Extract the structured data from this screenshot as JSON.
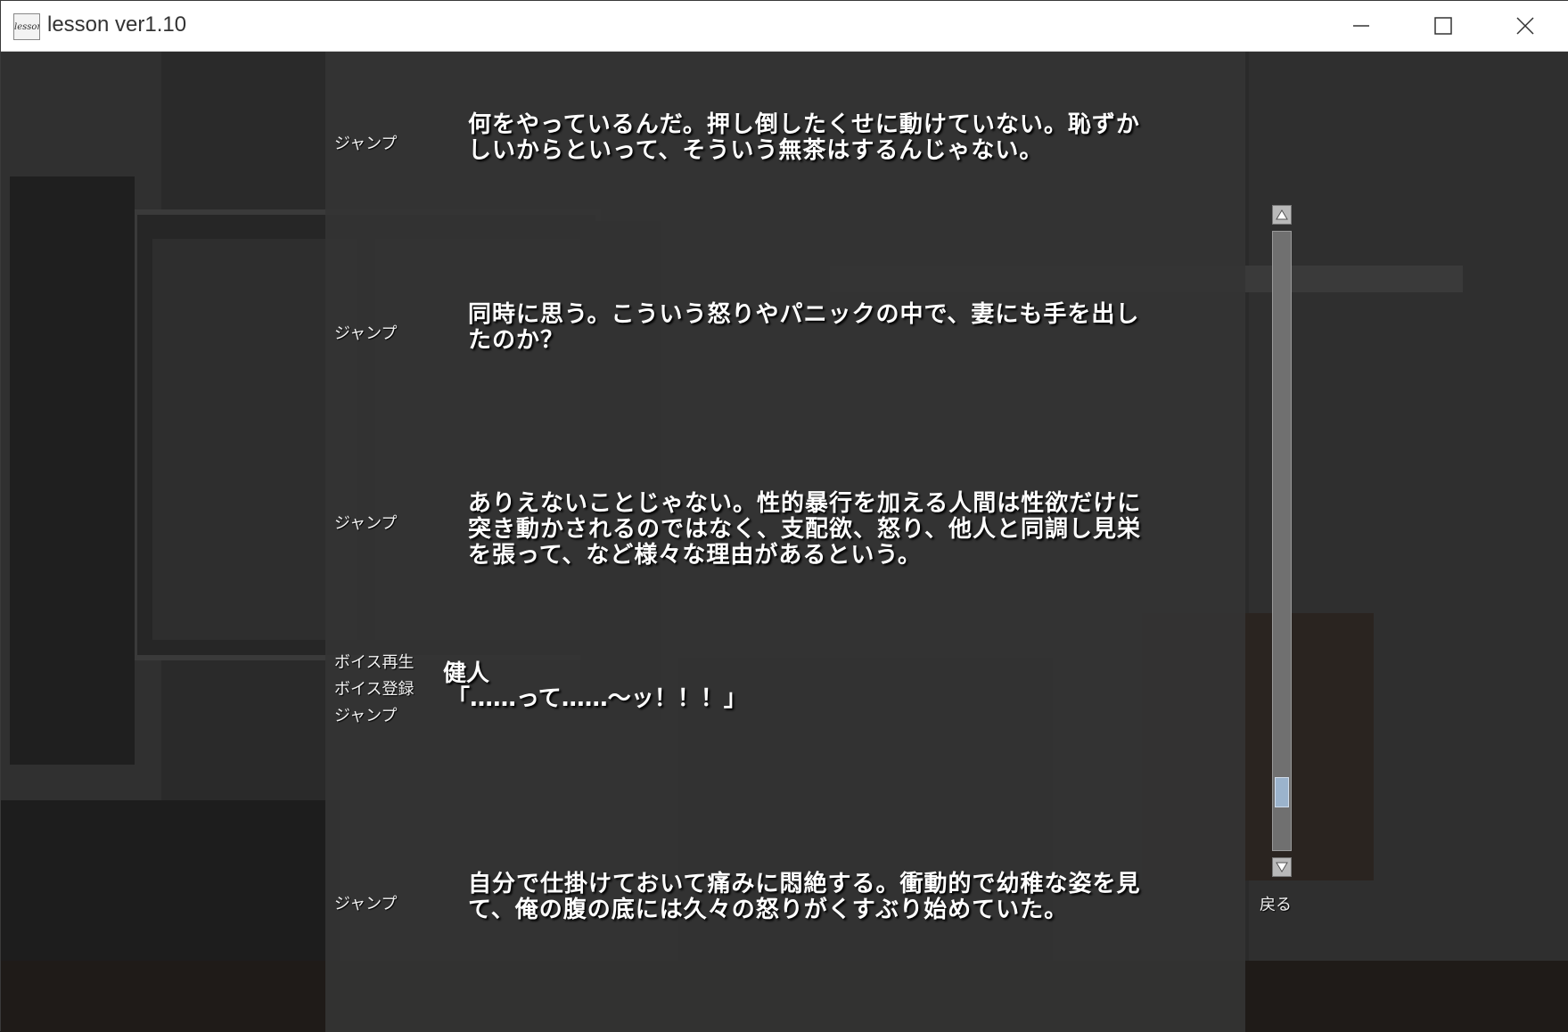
{
  "window": {
    "title": "lesson ver1.10",
    "app_icon_text": "lesson",
    "minimize_icon": "minimize-icon",
    "maximize_icon": "maximize-icon",
    "close_icon": "close-icon"
  },
  "backlog": {
    "jump_label": "ジャンプ",
    "voice_play_label": "ボイス再生",
    "voice_register_label": "ボイス登録",
    "entries": [
      {
        "text_lines": [
          "何をやっているんだ。押し倒したくせに動けていない。恥ずか",
          "しいからといって、そういう無茶はするんじゃない。"
        ]
      },
      {
        "text_lines": [
          "同時に思う。こういう怒りやパニックの中で、妻にも手を出し",
          "たのか？"
        ]
      },
      {
        "text_lines": [
          "ありえないことじゃない。性的暴行を加える人間は性欲だけに",
          "突き動かされるのではなく、支配欲、怒り、他人と同調し見栄",
          "を張って、など様々な理由があるという。"
        ]
      },
      {
        "speaker": "健人",
        "line": "「……って……～ッ！！！」"
      },
      {
        "text_lines": [
          "自分で仕掛けておいて痛みに悶絶する。衝動的で幼稚な姿を見",
          "て、俺の腹の底には久々の怒りがくすぶり始めていた。"
        ]
      }
    ],
    "back_label": "戻る",
    "scroll_position": 0.93
  }
}
